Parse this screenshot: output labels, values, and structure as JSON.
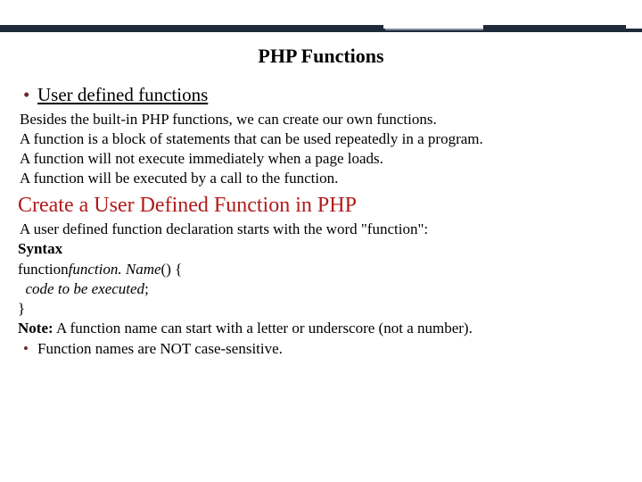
{
  "title": "PHP Functions",
  "bullet1": "User defined functions",
  "para1_l1": "Besides the built-in PHP functions, we can create our own functions.",
  "para1_l2": "A function is a block of statements that can be used repeatedly in a program.",
  "para1_l3": "A function will not execute immediately when a page loads.",
  "para1_l4": "A function will be executed by a call to the function.",
  "heading2": "Create a User Defined Function in PHP",
  "para2": "A user defined function declaration starts with the word \"function\":",
  "syntax_label": "Syntax",
  "syntax_kw": "function",
  "syntax_name": "function. Name",
  "syntax_rest": "() {",
  "syntax_body": "code to be executed",
  "syntax_semi": ";",
  "syntax_close": "}",
  "note_label": "Note:",
  "note_text": " A function name can start with a letter or underscore (not a number).",
  "bullet2": "Function names are NOT case-sensitive."
}
